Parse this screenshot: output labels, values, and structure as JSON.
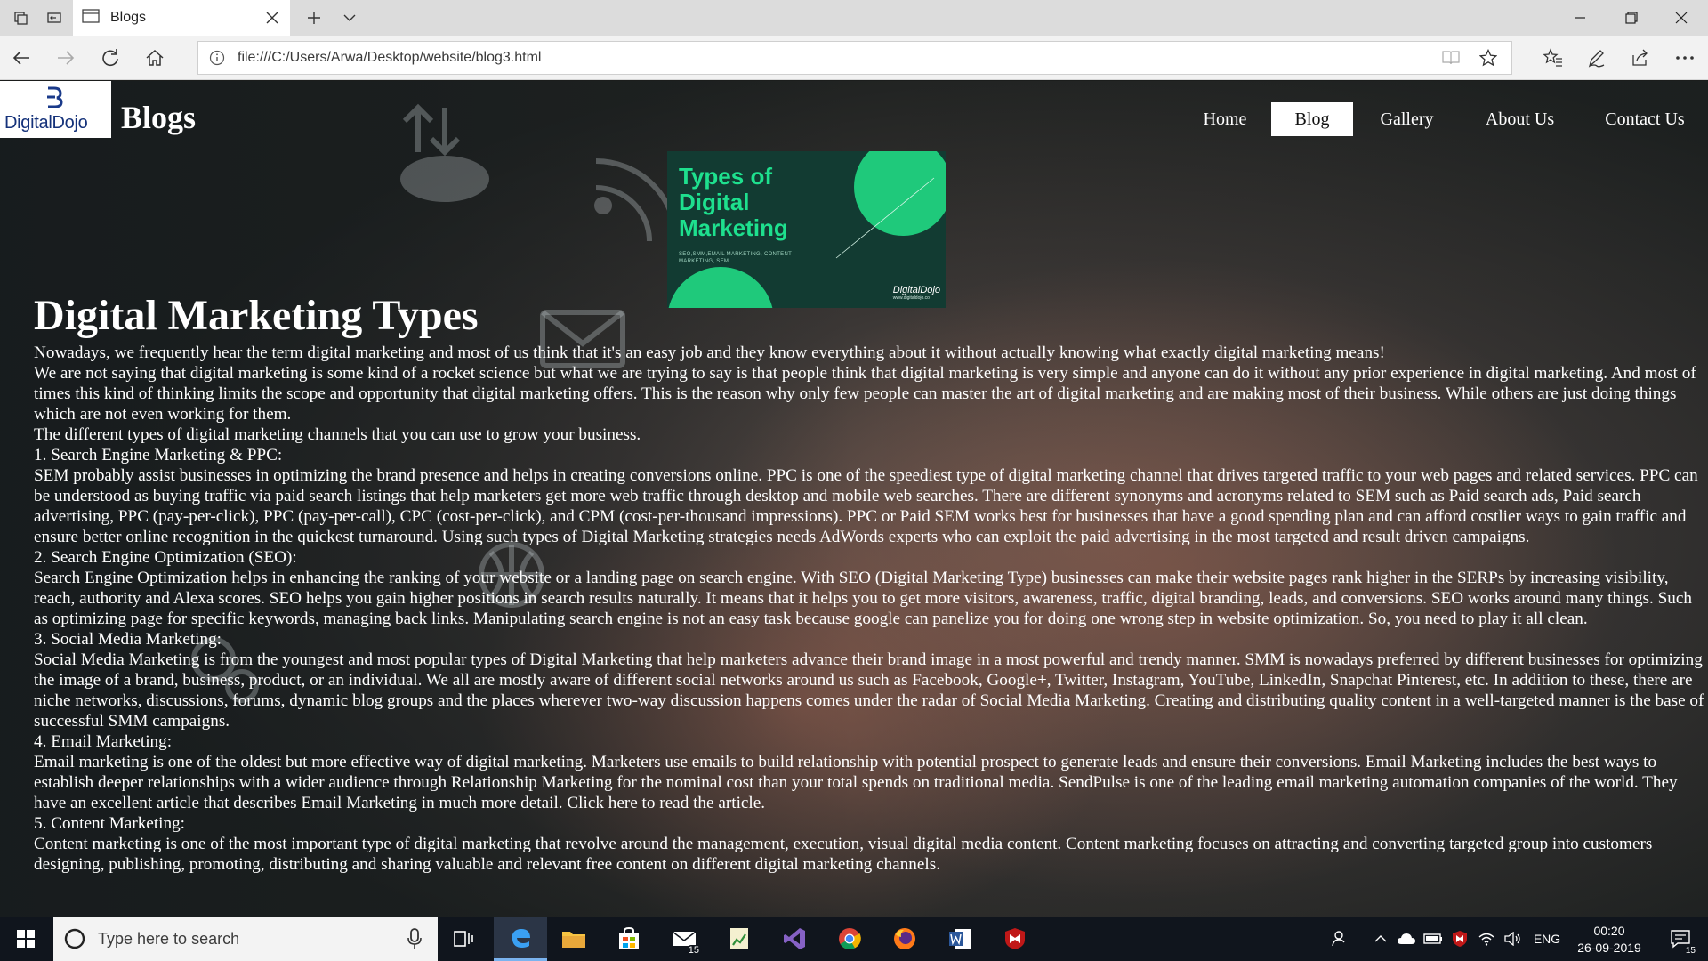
{
  "browser": {
    "tab_title": "Blogs",
    "url": "file:///C:/Users/Arwa/Desktop/website/blog3.html"
  },
  "site": {
    "logo_text": "DigitalDojo",
    "title": "Blogs",
    "nav": [
      {
        "label": "Home"
      },
      {
        "label": "Blog"
      },
      {
        "label": "Gallery"
      },
      {
        "label": "About Us"
      },
      {
        "label": "Contact Us"
      }
    ],
    "active_nav": "Blog"
  },
  "hero": {
    "title": "Types of\nDigital\nMarketing",
    "subtitle": "SEO,SMM,EMAIL MARKETING, CONTENT\nMARKETING, SEM",
    "logo": "DigitalDojo",
    "logo_url": "www.digitaldojo.co"
  },
  "article": {
    "heading": "Digital Marketing Types",
    "lines": [
      "Nowadays, we frequently hear the term digital marketing and most of us think that it's an easy job and they know everything about it without actually knowing what exactly digital marketing means!",
      "We are not saying that digital marketing is some kind of a rocket science but what we are trying to say is that people think that digital marketing is very simple and anyone can do it without any prior experience in digital marketing. And most of times this kind of thinking limits the scope and opportunity that digital marketing offers. This is the reason why only few people can master the art of digital marketing and are making most of their business. While others are just doing things which are not even working for them.",
      "The different types of digital marketing channels that you can use to grow your business.",
      "1. Search Engine Marketing & PPC:",
      "SEM probably assist businesses in optimizing the brand presence and helps in creating conversions online. PPC is one of the speediest type of digital marketing channel that drives targeted traffic to your web pages and related services. PPC can be understood as buying traffic via paid search listings that help marketers get more web traffic through desktop and mobile web searches. There are different synonyms and acronyms related to SEM such as Paid search ads, Paid search advertising, PPC (pay-per-click), PPC (pay-per-call), CPC (cost-per-click), and CPM (cost-per-thousand impressions). PPC or Paid SEM works best for businesses that have a good spending plan and can afford costlier ways to gain traffic and ensure better online recognition in the quickest turnaround. Using such types of Digital Marketing strategies needs AdWords experts who can exploit the paid advertising in the most targeted and result driven campaigns.",
      "2. Search Engine Optimization (SEO):",
      "Search Engine Optimization helps in enhancing the ranking of your website or a landing page on search engine. With SEO (Digital Marketing Type) businesses can make their website pages rank higher in the SERPs by increasing visibility, reach, authority and Alexa scores. SEO helps you gain higher positions in search results naturally. It means that it helps you to get more visitors, awareness, traffic, digital branding, leads, and conversions. SEO works around many things. Such as optimizing page for specific keywords, managing back links. Manipulating search engine is not an easy task because google can panelize you for doing one wrong step in website optimization. So, you need to play it all clean.",
      "3. Social Media Marketing:",
      "Social Media Marketing is from the youngest and most popular types of Digital Marketing that help marketers advance their brand image in a most powerful and trendy manner. SMM is nowadays preferred by different businesses for optimizing the image of a brand, business, product, or an individual. We all are mostly aware of different social networks around us such as Facebook, Google+, Twitter, Instagram, YouTube, LinkedIn, Snapchat Pinterest, etc. In addition to these, there are niche networks, discussions, forums, dynamic blog groups and the places wherever two-way discussion happens comes under the radar of Social Media Marketing. Creating and distributing quality content in a well-targeted manner is the base of successful SMM campaigns.",
      "4. Email Marketing:",
      "Email marketing is one of the oldest but more effective way of digital marketing. Marketers use emails to build relationship with potential prospect to generate leads and ensure their conversions. Email Marketing includes the best ways to establish deeper relationships with a wider audience through Relationship Marketing for the nominal cost than your total spends on traditional media. SendPulse is one of the leading email marketing automation companies of the world. They have an excellent article that describes Email Marketing in much more detail. Click here to read the article.",
      "5. Content Marketing:",
      "Content marketing is one of the most important type of digital marketing that revolve around the management, execution, visual digital media content. Content marketing focuses on attracting and converting targeted group into customers designing, publishing, promoting, distributing and sharing valuable and relevant free content on different digital marketing channels."
    ]
  },
  "taskbar": {
    "search_placeholder": "Type here to search",
    "mail_badge": "15",
    "language": "ENG",
    "time": "00:20",
    "date": "26-09-2019",
    "notification_count": "15"
  },
  "colors": {
    "hero_bg": "#123b32",
    "hero_accent": "#1ee08e",
    "taskbar_bg": "#10151d",
    "edge_blue": "#3aa0f3"
  }
}
